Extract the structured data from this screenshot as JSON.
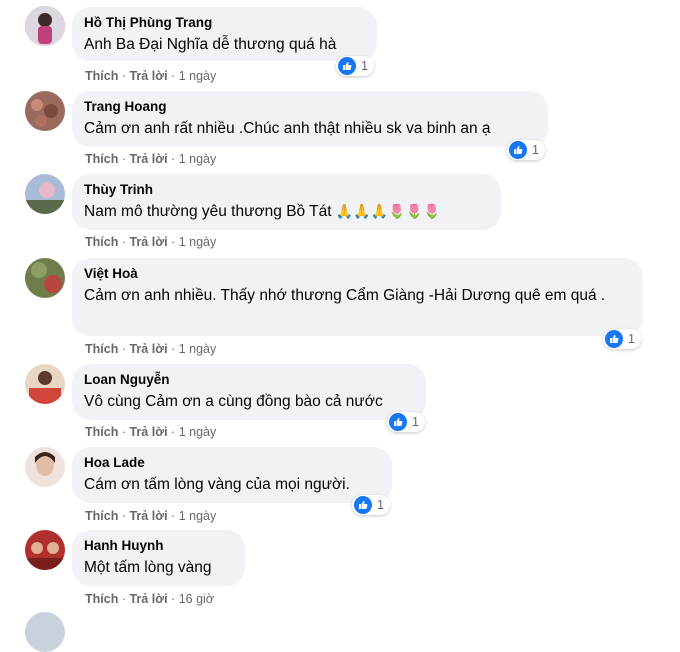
{
  "labels": {
    "like": "Thích",
    "reply": "Trả lời",
    "sep": "·"
  },
  "comments": [
    {
      "author": "Hồ Thị Phùng Trang",
      "text": "Anh Ba Đại Nghĩa dễ thương quá hà",
      "time": "1 ngày",
      "reactions": "1",
      "avatar_color": "#c05a7a"
    },
    {
      "author": "Trang Hoang",
      "text": "Cảm ơn anh rất nhiều .Chúc anh thật nhiều sk va binh an ạ",
      "time": "1 ngày",
      "reactions": "1",
      "avatar_color": "#8a5a4e"
    },
    {
      "author": "Thùy Trinh",
      "text": "Nam mô thường yêu thương Bồ Tát",
      "emoji": "🙏🙏🙏🌷🌷🌷",
      "time": "1 ngày",
      "avatar_color": "#7b8fb0"
    },
    {
      "author": "Việt Hoà",
      "text": "Cảm ơn anh nhiều. Thấy nhớ thương Cẩm Giàng -Hải Dương quê em quá .",
      "time": "1 ngày",
      "reactions": "1",
      "avatar_color": "#6c7a4a"
    },
    {
      "author": "Loan Nguyễn",
      "text": "Vô cùng Cảm ơn a cùng đồng bào cả nước",
      "time": "1 ngày",
      "reactions": "1",
      "avatar_color": "#c0603e"
    },
    {
      "author": "Hoa Lade",
      "text": "Cám ơn tấm lòng vàng của mọi người.",
      "time": "1 ngày",
      "reactions": "1",
      "avatar_color": "#d9b8a8"
    },
    {
      "author": "Hanh Huynh",
      "text": "Một tấm lòng vàng",
      "time": "16 giờ",
      "avatar_color": "#b0302e"
    }
  ],
  "colors": {
    "bubble": "#f0f2f5",
    "like_blue": "#1877f2",
    "meta": "#65676b"
  }
}
